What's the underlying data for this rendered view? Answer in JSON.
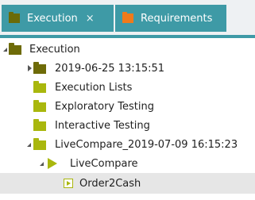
{
  "tabs": [
    {
      "label": "Execution",
      "close": "×",
      "active": true
    },
    {
      "label": "Requirements",
      "active": false
    }
  ],
  "tree": [
    {
      "label": "Execution",
      "expander": "open",
      "icon": "folder-dark"
    },
    {
      "label": "2019-06-25 13:15:51",
      "expander": "closed",
      "icon": "folder-dark"
    },
    {
      "label": "Execution Lists",
      "expander": "none",
      "icon": "folder"
    },
    {
      "label": "Exploratory Testing",
      "expander": "none",
      "icon": "folder"
    },
    {
      "label": "Interactive Testing",
      "expander": "none",
      "icon": "folder"
    },
    {
      "label": "LiveCompare_2019-07-09 16:15:23",
      "expander": "open",
      "icon": "folder"
    },
    {
      "label": "LiveCompare",
      "expander": "open",
      "icon": "play"
    },
    {
      "label": "Order2Cash",
      "expander": "none",
      "icon": "flow",
      "selected": true
    }
  ],
  "colors": {
    "tab": "#3e9aa6",
    "folder": "#a9b70d",
    "folder_dark": "#6e6b08",
    "requirements_icon": "#f07a1a"
  }
}
